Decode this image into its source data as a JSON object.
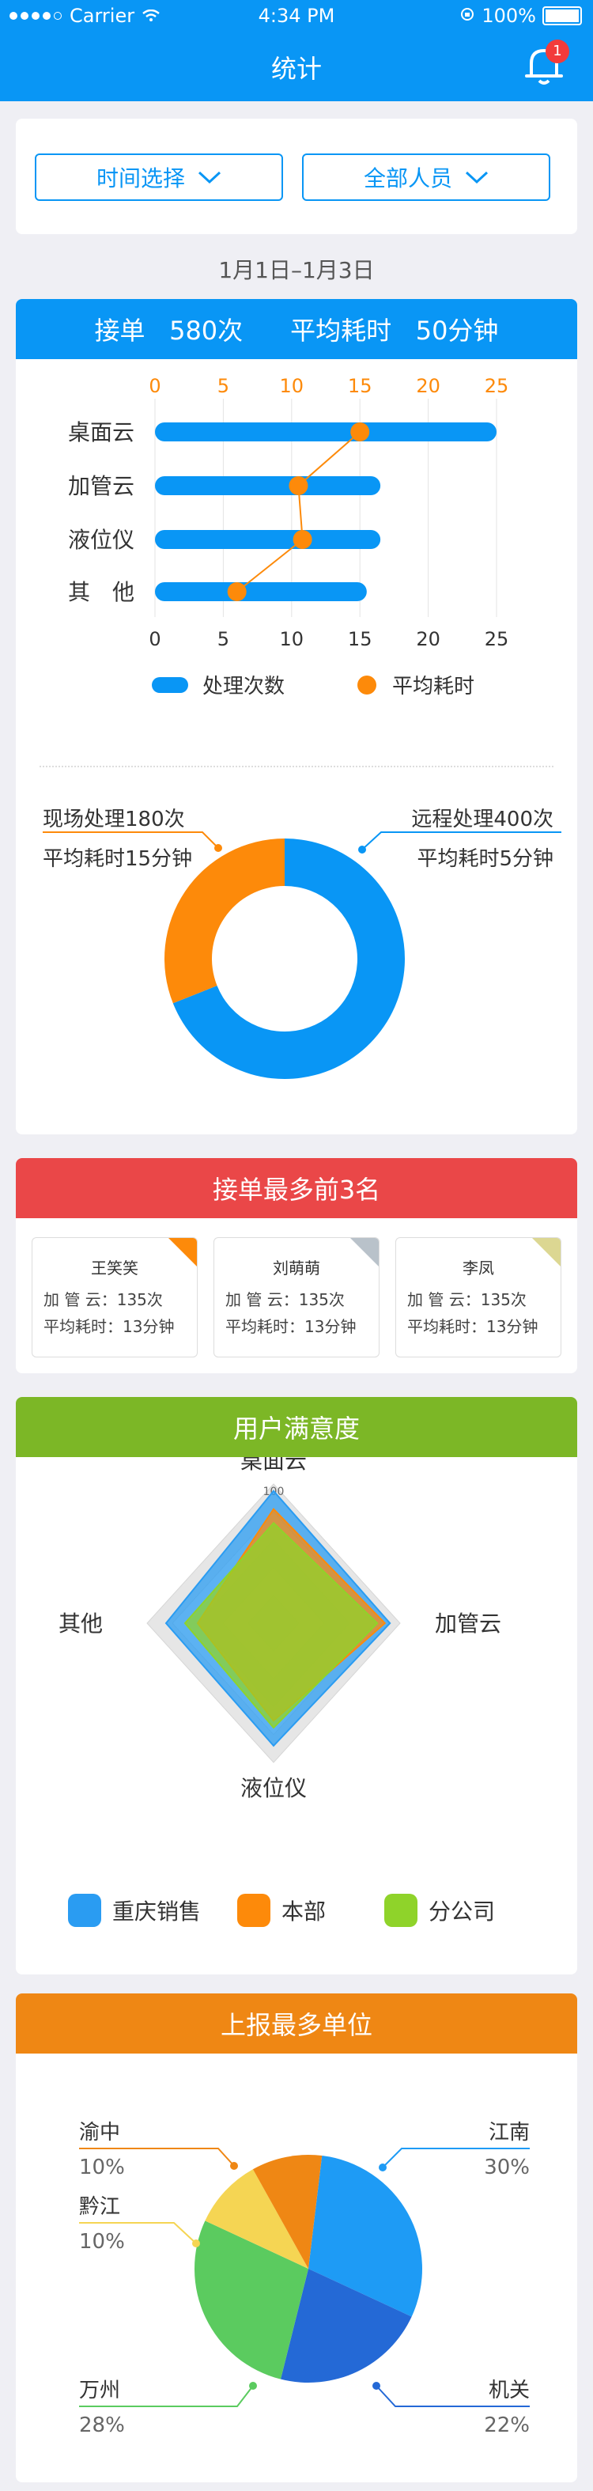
{
  "status_bar": {
    "carrier": "Carrier",
    "time": "4:34 PM",
    "battery": "100%"
  },
  "header": {
    "title": "统计",
    "notification_count": "1"
  },
  "filters": {
    "time_label": "时间选择",
    "people_label": "全部人员"
  },
  "date_range": "1月1日–1月3日",
  "summary": {
    "orders_label": "接单",
    "orders_value": "580次",
    "avg_label": "平均耗时",
    "avg_value": "50分钟"
  },
  "colors": {
    "blue": "#0996f5",
    "orange": "#fd8a0a",
    "red": "#ea4748",
    "green": "#7cb726",
    "report_orange": "#ef8714"
  },
  "chart_data": [
    {
      "type": "bar",
      "orientation": "horizontal",
      "categories": [
        "桌面云",
        "加管云",
        "液位仪",
        "其　他"
      ],
      "series": [
        {
          "name": "处理次数",
          "values": [
            25,
            16.5,
            16.5,
            15.5
          ]
        },
        {
          "name": "平均耗时",
          "values": [
            15,
            10.5,
            10.8,
            6
          ]
        }
      ],
      "x_ticks": [
        "0",
        "5",
        "10",
        "15",
        "20",
        "25"
      ],
      "xlim": [
        0,
        25
      ],
      "legend": "bottom"
    },
    {
      "type": "pie",
      "style": "donut",
      "slices": [
        {
          "label": "远程处理400次",
          "sublabel": "平均耗时5分钟",
          "value": 400,
          "color": "#0996f5"
        },
        {
          "label": "现场处理180次",
          "sublabel": "平均耗时15分钟",
          "value": 180,
          "color": "#fd8a0a"
        }
      ]
    },
    {
      "type": "radar",
      "title": "用户满意度",
      "axes": [
        "桌面云",
        "加管云",
        "液位仪",
        "其他"
      ],
      "max": 100,
      "tick_label": "100",
      "series": [
        {
          "name": "重庆销售",
          "values": [
            95,
            92,
            88,
            85
          ],
          "color": "#2a9cf2"
        },
        {
          "name": "本部",
          "values": [
            82,
            88,
            70,
            60
          ],
          "color": "#fd8a0a"
        },
        {
          "name": "分公司",
          "values": [
            72,
            82,
            75,
            70
          ],
          "color": "#8fd32a"
        }
      ],
      "legend": "bottom"
    },
    {
      "type": "pie",
      "title": "上报最多单位",
      "slices": [
        {
          "label": "江南",
          "value": 30,
          "value_label": "30%",
          "color": "#1e9bf5"
        },
        {
          "label": "机关",
          "value": 22,
          "value_label": "22%",
          "color": "#2469d6"
        },
        {
          "label": "万州",
          "value": 28,
          "value_label": "28%",
          "color": "#5bcb5f"
        },
        {
          "label": "黔江",
          "value": 10,
          "value_label": "10%",
          "color": "#f5d553"
        },
        {
          "label": "渝中",
          "value": 10,
          "value_label": "10%",
          "color": "#ef8714"
        }
      ]
    }
  ],
  "top3": {
    "title": "接单最多前3名",
    "people": [
      {
        "name": "王笑笑",
        "line1": "加 管 云：135次",
        "line2": "平均耗时：13分钟",
        "corner": "#fd8a0a"
      },
      {
        "name": "刘萌萌",
        "line1": "加 管 云：135次",
        "line2": "平均耗时：13分钟",
        "corner": "#b9c2ca"
      },
      {
        "name": "李凤",
        "line1": "加 管 云：135次",
        "line2": "平均耗时：13分钟",
        "corner": "#dcd792"
      }
    ]
  },
  "satisfaction": {
    "title": "用户满意度"
  },
  "report": {
    "title": "上报最多单位"
  }
}
